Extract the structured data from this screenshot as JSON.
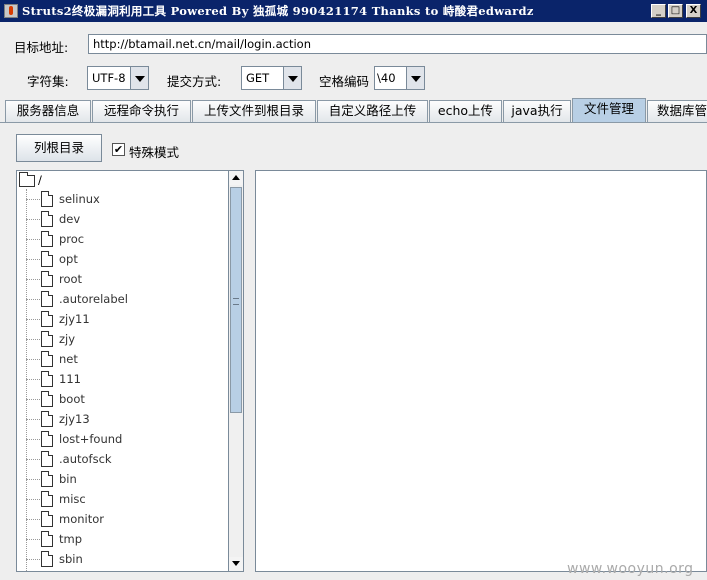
{
  "window": {
    "title": "Struts2终极漏洞利用工具  Powered By 独孤城 990421174 Thanks to 峙酸君edwardz",
    "min_label": "_",
    "max_label": "□",
    "close_label": "X"
  },
  "form": {
    "target_label": "目标地址:",
    "target_value": "http://btamail.net.cn/mail/login.action",
    "charset_label": "字符集:",
    "charset_value": "UTF-8",
    "method_label": "提交方式:",
    "method_value": "GET",
    "space_label": "空格编码",
    "space_value": "\\40"
  },
  "tabs": [
    {
      "label": "服务器信息"
    },
    {
      "label": "远程命令执行"
    },
    {
      "label": "上传文件到根目录"
    },
    {
      "label": "自定义路径上传"
    },
    {
      "label": "echo上传"
    },
    {
      "label": "java执行"
    },
    {
      "label": "文件管理",
      "active": true
    },
    {
      "label": "数据库管"
    }
  ],
  "file_manager": {
    "list_root_button": "列根目录",
    "special_mode_label": "特殊模式",
    "special_mode_checked": "✔",
    "root": "/",
    "items": [
      "selinux",
      "dev",
      "proc",
      "opt",
      "root",
      ".autorelabel",
      "zjy11",
      "zjy",
      "net",
      "111",
      "boot",
      "zjy13",
      "lost+found",
      ".autofsck",
      "bin",
      "misc",
      "monitor",
      "tmp",
      "sbin"
    ]
  },
  "watermark": "www.wooyun.org"
}
